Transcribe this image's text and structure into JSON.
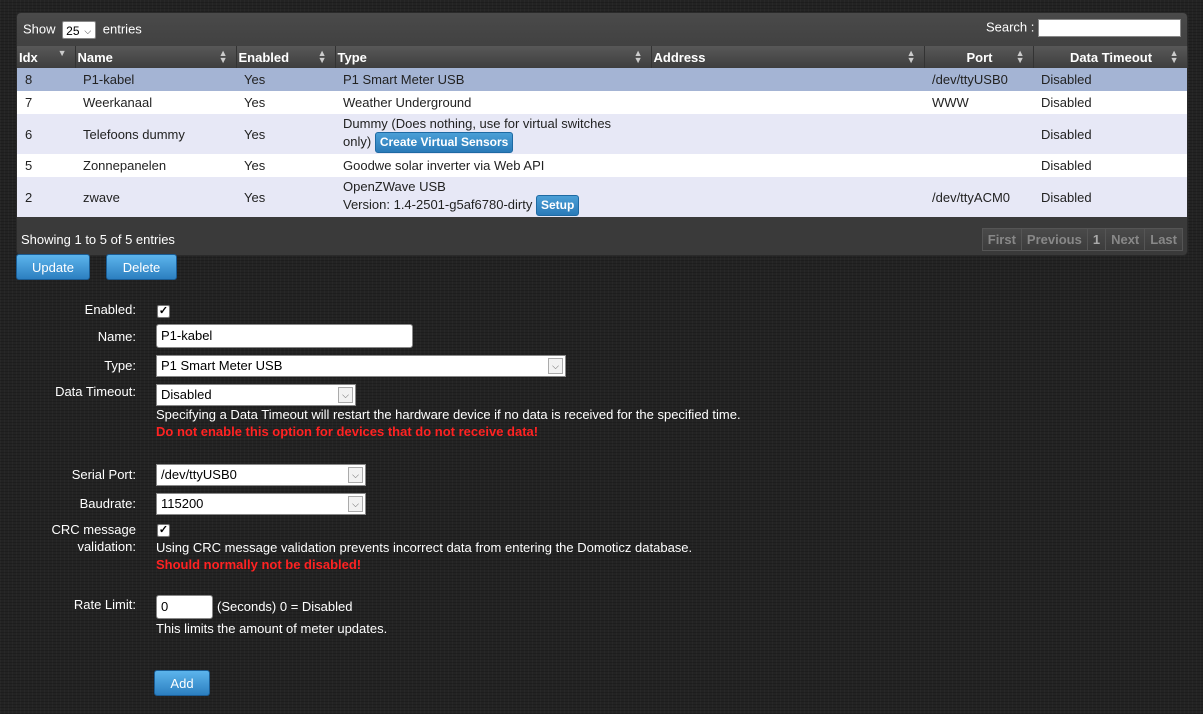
{
  "table": {
    "show_label": "Show",
    "show_value": "25",
    "entries_label": "entries",
    "search_label": "Search :",
    "columns": [
      "Idx",
      "Name",
      "Enabled",
      "Type",
      "Address",
      "Port",
      "Data Timeout"
    ],
    "rows": [
      {
        "idx": "8",
        "name": "P1-kabel",
        "enabled": "Yes",
        "type": "P1 Smart Meter USB",
        "address": "",
        "port": "/dev/ttyUSB0",
        "timeout": "Disabled"
      },
      {
        "idx": "7",
        "name": "Weerkanaal",
        "enabled": "Yes",
        "type": "Weather Underground",
        "address": "",
        "port": "WWW",
        "timeout": "Disabled"
      },
      {
        "idx": "6",
        "name": "Telefoons dummy",
        "enabled": "Yes",
        "type_line1": "Dummy (Does nothing, use for virtual switches",
        "type_line2": "only)",
        "type_button": "Create Virtual Sensors",
        "address": "",
        "port": "",
        "timeout": "Disabled"
      },
      {
        "idx": "5",
        "name": "Zonnepanelen",
        "enabled": "Yes",
        "type": "Goodwe solar inverter via Web API",
        "address": "",
        "port": "",
        "timeout": "Disabled"
      },
      {
        "idx": "2",
        "name": "zwave",
        "enabled": "Yes",
        "type_line1": "OpenZWave USB",
        "type_line2": "Version: 1.4-2501-g5af6780-dirty",
        "type_button": "Setup",
        "address": "",
        "port": "/dev/ttyACM0",
        "timeout": "Disabled"
      }
    ],
    "info": "Showing 1 to 5 of 5 entries",
    "pager": {
      "first": "First",
      "previous": "Previous",
      "page": "1",
      "next": "Next",
      "last": "Last"
    }
  },
  "actions": {
    "update": "Update",
    "delete": "Delete"
  },
  "form": {
    "enabled_label": "Enabled:",
    "enabled_checked": "✓",
    "name_label": "Name:",
    "name_value": "P1-kabel",
    "type_label": "Type:",
    "type_value": "P1 Smart Meter USB",
    "timeout_label": "Data Timeout:",
    "timeout_value": "Disabled",
    "timeout_help": "Specifying a Data Timeout will restart the hardware device if no data is received for the specified time.",
    "timeout_warn": "Do not enable this option for devices that do not receive data!",
    "serial_label": "Serial Port:",
    "serial_value": "/dev/ttyUSB0",
    "baud_label": "Baudrate:",
    "baud_value": "115200",
    "crc_label_line1": "CRC message",
    "crc_label_line2": "validation:",
    "crc_checked": "✓",
    "crc_help": "Using CRC message validation prevents incorrect data from entering the Domoticz database.",
    "crc_warn": "Should normally not be disabled!",
    "rate_label": "Rate Limit:",
    "rate_value": "0",
    "rate_unit": "(Seconds) 0 = Disabled",
    "rate_help": "This limits the amount of meter updates.",
    "add": "Add"
  }
}
